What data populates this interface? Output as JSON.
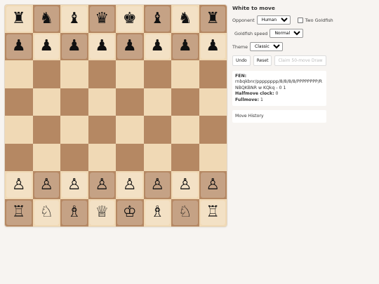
{
  "board": {
    "rows": [
      [
        "♜",
        "♞",
        "♝",
        "♛",
        "♚",
        "♝",
        "♞",
        "♜"
      ],
      [
        "♟",
        "♟",
        "♟",
        "♟",
        "♟",
        "♟",
        "♟",
        "♟"
      ],
      [
        "",
        "",
        "",
        "",
        "",
        "",
        "",
        ""
      ],
      [
        "",
        "",
        "",
        "",
        "",
        "",
        "",
        ""
      ],
      [
        "",
        "",
        "",
        "",
        "",
        "",
        "",
        ""
      ],
      [
        "",
        "",
        "",
        "",
        "",
        "",
        "",
        ""
      ],
      [
        "♙",
        "♙",
        "♙",
        "♙",
        "♙",
        "♙",
        "♙",
        "♙"
      ],
      [
        "♖",
        "♘",
        "♗",
        "♕",
        "♔",
        "♗",
        "♘",
        "♖"
      ]
    ]
  },
  "status": "White to move",
  "opponent": {
    "label": "Opponent",
    "value": "Human",
    "two_goldfish_label": "Two Goldfish"
  },
  "goldfish_speed": {
    "label": "Goldfish speed",
    "value": "Normal"
  },
  "theme": {
    "label": "Theme",
    "value": "Classic"
  },
  "buttons": {
    "undo": "Undo",
    "reset": "Reset",
    "claim_draw": "Claim 50-move Draw"
  },
  "fen": {
    "label": "FEN:",
    "value": "rnbqkbnr/pppppppp/8/8/8/8/PPPPPPPP/RNBQKBNR w KQkq - 0 1",
    "halfmove_label": "Halfmove clock:",
    "halfmove_value": "0",
    "fullmove_label": "Fullmove:",
    "fullmove_value": "1"
  },
  "move_history_label": "Move History",
  "colors": {
    "light_square": "#f0d9b5",
    "dark_square": "#b58863"
  }
}
